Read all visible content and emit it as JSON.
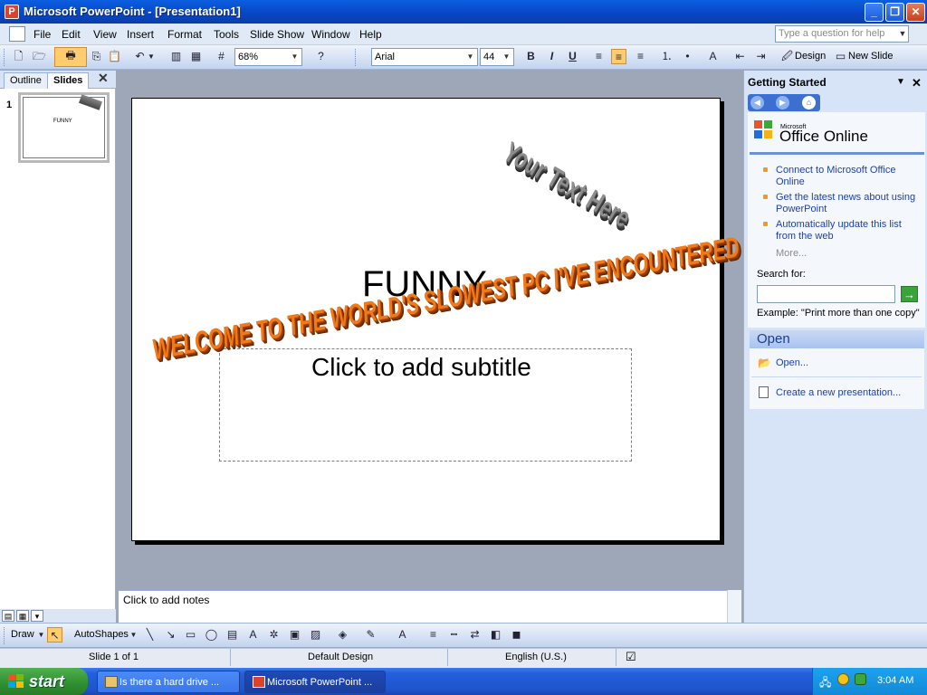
{
  "window": {
    "title": "Microsoft PowerPoint - [Presentation1]",
    "app_icon": "P"
  },
  "window_controls": {
    "minimize": "_",
    "restore": "❐",
    "close": "✕"
  },
  "menu": {
    "items": [
      "File",
      "Edit",
      "View",
      "Insert",
      "Format",
      "Tools",
      "Slide Show",
      "Window",
      "Help"
    ]
  },
  "help_box": {
    "placeholder": "Type a question for help"
  },
  "toolbar": {
    "zoom": "68%",
    "font": "Arial",
    "font_size": "44",
    "bold": "B",
    "italic": "I",
    "underline": "U",
    "design_label": "Design",
    "new_slide_label": "New Slide"
  },
  "left_panel": {
    "tabs": [
      "Outline",
      "Slides"
    ],
    "active_tab": "Slides",
    "close": "✕",
    "thumbnail_number": "1",
    "thumbnail_title": "FUNNY"
  },
  "slide": {
    "title": "FUNNY",
    "subtitle": "Click to add subtitle",
    "wordart_1": "Your Text Here",
    "wordart_2": "WELCOME TO THE WORLD'S SLOWEST PC I'VE ENCOUNTERED"
  },
  "notes": {
    "placeholder": "Click to add notes"
  },
  "task_pane": {
    "header": "Getting Started",
    "close": "✕",
    "logo_small": "Microsoft",
    "logo_big": "Office Online",
    "links": [
      "Connect to Microsoft Office Online",
      "Get the latest news about using PowerPoint",
      "Automatically update this list from the web"
    ],
    "more": "More...",
    "search_label": "Search for:",
    "search_go": "→",
    "example": "Example:  \"Print more than one copy\"",
    "open_header": "Open",
    "open_link": "Open...",
    "new_link": "Create a new presentation..."
  },
  "draw_toolbar": {
    "draw_label": "Draw",
    "autoshapes_label": "AutoShapes"
  },
  "status_bar": {
    "slide_info": "Slide 1 of 1",
    "design": "Default Design",
    "language": "English (U.S.)"
  },
  "taskbar": {
    "start": "start",
    "tasks": [
      "Is there a hard drive ...",
      "Microsoft PowerPoint ..."
    ],
    "clock": "3:04 AM"
  },
  "colors": {
    "title_bar": "#0a5fe0",
    "taskbar": "#245fdc",
    "start_button": "#2f8f2f",
    "task_pane": "#d7e4f7",
    "wordart_orange": "#ef7a1a"
  }
}
